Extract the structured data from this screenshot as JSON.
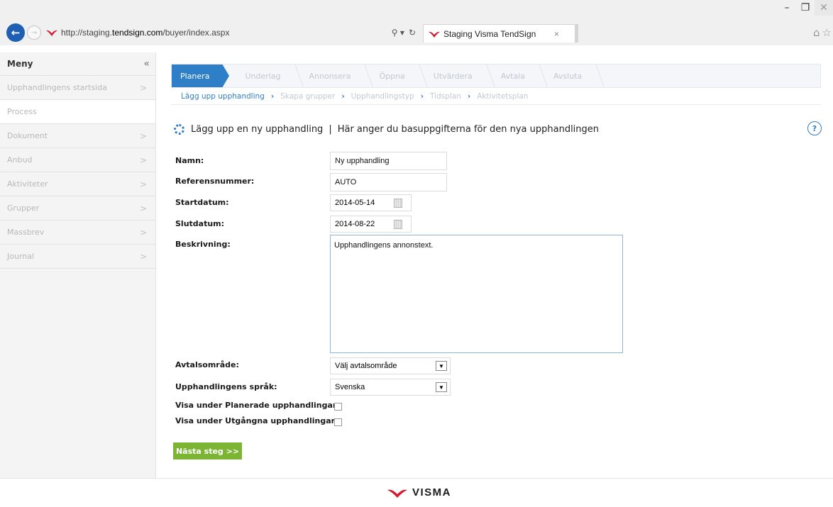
{
  "browser": {
    "url_prefix": "http://staging.",
    "url_host": "tendsign.com",
    "url_path": "/buyer/index.aspx",
    "tab_title": "Staging Visma TendSign",
    "tab_close": "×",
    "search_glyph": "⚲ ▾",
    "refresh_glyph": "↻"
  },
  "sidebar": {
    "title": "Meny",
    "collapse_glyph": "«",
    "items": [
      {
        "label": "Upphandlingens startsida",
        "chevron": ">"
      },
      {
        "label": "Process",
        "chevron": ""
      },
      {
        "label": "Dokument",
        "chevron": ">"
      },
      {
        "label": "Anbud",
        "chevron": ">"
      },
      {
        "label": "Aktiviteter",
        "chevron": ">"
      },
      {
        "label": "Grupper",
        "chevron": ">"
      },
      {
        "label": "Massbrev",
        "chevron": ">"
      },
      {
        "label": "Journal",
        "chevron": ">"
      }
    ]
  },
  "steps": [
    "Planera",
    "Underlag",
    "Annonsera",
    "Öppna",
    "Utvärdera",
    "Avtala",
    "Avsluta"
  ],
  "substeps": [
    "Lägg upp upphandling",
    "Skapa grupper",
    "Upphandlingstyp",
    "Tidsplan",
    "Aktivitetsplan"
  ],
  "page": {
    "title": "Lägg upp en ny upphandling",
    "separator": "|",
    "subtitle": "Här anger du basuppgifterna för den nya upphandlingen",
    "help": "?"
  },
  "form": {
    "namn_label": "Namn:",
    "namn_value": "Ny upphandling",
    "ref_label": "Referensnummer:",
    "ref_value": "AUTO",
    "start_label": "Startdatum:",
    "start_value": "2014-05-14",
    "slut_label": "Slutdatum:",
    "slut_value": "2014-08-22",
    "beskr_label": "Beskrivning:",
    "beskr_value": "Upphandlingens annonstext.",
    "avtal_label": "Avtalsområde:",
    "avtal_value": "Välj avtalsområde",
    "sprak_label": "Upphandlingens språk:",
    "sprak_value": "Svenska",
    "planerade_label": "Visa under Planerade upphandlingar:",
    "utgangna_label": "Visa under Utgångna upphandlingar:",
    "next_button": "Nästa steg >>"
  },
  "footer": {
    "logo_text": "VISMA"
  },
  "colors": {
    "accent": "#2f7ec8",
    "button": "#7cb534",
    "logo_red": "#d5172b"
  }
}
